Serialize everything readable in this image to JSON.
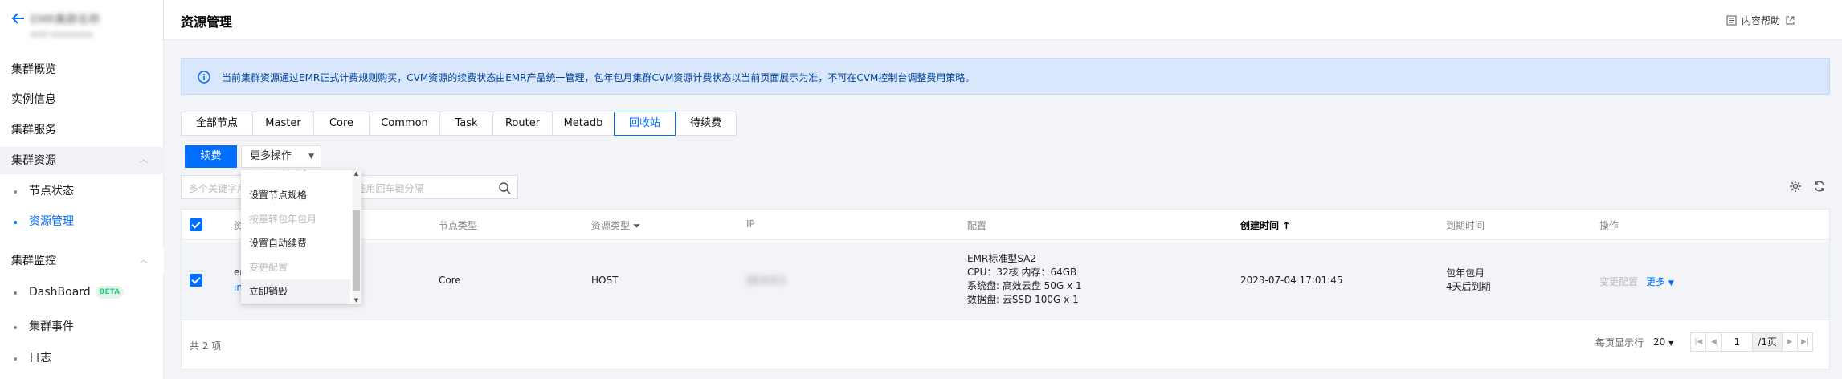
{
  "sidebar": {
    "cluster_name": "EMR集群名称",
    "cluster_sub": "emr-xxxxxxxx",
    "items": [
      {
        "label": "集群概览"
      },
      {
        "label": "实例信息"
      },
      {
        "label": "集群服务"
      }
    ],
    "group_resources": {
      "label": "集群资源",
      "children": [
        {
          "label": "节点状态"
        },
        {
          "label": "资源管理"
        }
      ]
    },
    "group_monitor": {
      "label": "集群监控",
      "children": [
        {
          "label": "DashBoard",
          "badge": "BETA"
        },
        {
          "label": "集群事件"
        },
        {
          "label": "日志"
        }
      ]
    }
  },
  "header": {
    "title": "资源管理",
    "help": "内容帮助"
  },
  "notice": "当前集群资源通过EMR正式计费规则购买，CVM资源的续费状态由EMR产品统一管理，包年包月集群CVM资源计费状态以当前页面展示为准，不可在CVM控制台调整费用策略。",
  "tabs": [
    {
      "label": "全部节点"
    },
    {
      "label": "Master"
    },
    {
      "label": "Core"
    },
    {
      "label": "Common"
    },
    {
      "label": "Task"
    },
    {
      "label": "Router"
    },
    {
      "label": "Metadb"
    },
    {
      "label": "回收站"
    },
    {
      "label": "待续费"
    }
  ],
  "toolbar": {
    "renew": "续费",
    "more": "更多操作"
  },
  "search": {
    "placeholder": "多个关键字用竖线“|”分隔，多个过滤标签用回车键分隔"
  },
  "table": {
    "columns": {
      "resource": "资源",
      "node_type": "节点类型",
      "resource_type": "资源类型",
      "ip": "IP",
      "config": "配置",
      "created": "创建时间",
      "expire": "到期时间",
      "actions": "操作"
    },
    "rows": [
      {
        "id_line1": "emr-xxxxxxxx",
        "id_line2": "ins-xxxxxxxx",
        "node_type": "Core",
        "resource_type": "HOST",
        "ip": "10.0.0.1",
        "config": [
          "EMR标准型SA2",
          "CPU：32核 内存：64GB",
          "系统盘: 高效云盘 50G x 1",
          "数据盘: 云SSD 100G x 1"
        ],
        "created": "2023-07-04 17:01:45",
        "expire": [
          "包年包月",
          "4天后到期"
        ],
        "action_disabled": "变更配置",
        "action_more": "更多"
      }
    ],
    "total": "共 2 项",
    "pagination": {
      "per_page_label": "每页显示行",
      "per_page": "20",
      "current": "1",
      "total_pages": "/1页"
    }
  },
  "dropdown": {
    "items": [
      {
        "label": "设置运维类别",
        "disabled": false
      },
      {
        "label": "设置节点规格",
        "disabled": false
      },
      {
        "label": "按量转包年包月",
        "disabled": true
      },
      {
        "label": "设置自动续费",
        "disabled": false
      },
      {
        "label": "变更配置",
        "disabled": true
      },
      {
        "label": "立即销毁",
        "disabled": false
      }
    ]
  },
  "colors": {
    "primary": "#006eff",
    "notice_bg": "#d9e7fd"
  }
}
